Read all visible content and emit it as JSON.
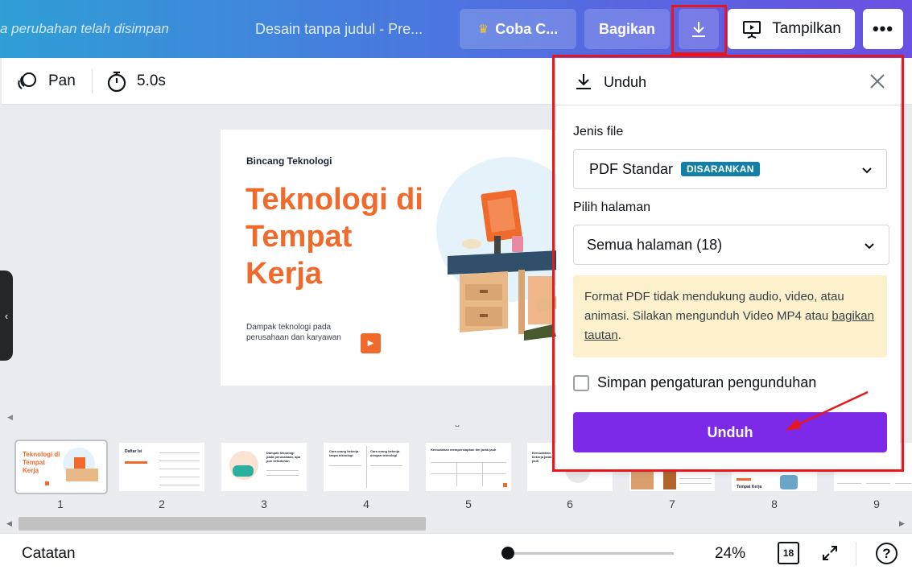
{
  "topbar": {
    "saved_message": "a perubahan telah disimpan",
    "doc_title": "Desain tanpa judul - Pre...",
    "try_pro_label": "Coba C...",
    "share_label": "Bagikan",
    "present_label": "Tampilkan",
    "more_label": "•••"
  },
  "toolbar": {
    "pan_label": "Pan",
    "timer_label": "5.0s"
  },
  "slide": {
    "kicker": "Bincang Teknologi",
    "title": "Teknologi di Tempat Kerja",
    "description": "Dampak teknologi pada perusahaan dan karyawan"
  },
  "thumbnails": [
    {
      "number": "1"
    },
    {
      "number": "2"
    },
    {
      "number": "3"
    },
    {
      "number": "4"
    },
    {
      "number": "5"
    },
    {
      "number": "6"
    },
    {
      "number": "7"
    },
    {
      "number": "8"
    },
    {
      "number": "9"
    }
  ],
  "thumb_text": {
    "t1_title": "Teknologi di Tempat Kerja",
    "t2_title": "Daftar Isi",
    "t3_title": "Dampak teknologi pada perusahaan, apa pun kebutuhan",
    "t4_left": "Cara orang bekerja tanpa teknologi",
    "t4_right": "Cara orang bekerja dengan teknologi",
    "t5_title": "Kemudahan mempersiapkan tim jarak jauh",
    "t6_title": "Kemudahan bekerja jarak jauh",
    "t8_title": "Tempat Kerja"
  },
  "footer": {
    "notes_label": "Catatan",
    "zoom_value": "24%",
    "page_count": "18",
    "help_label": "?",
    "zoom_level": 0.0
  },
  "download_panel": {
    "title": "Unduh",
    "file_type_label": "Jenis file",
    "file_type_value": "PDF Standar",
    "recommended_badge": "DISARANKAN",
    "pages_label": "Pilih halaman",
    "pages_value": "Semua halaman (18)",
    "notice_text": "Format PDF tidak mendukung audio, video, atau animasi. Silakan mengunduh Video MP4 atau ",
    "notice_link": "bagikan tautan",
    "notice_end": ".",
    "save_settings_label": "Simpan pengaturan pengunduhan",
    "save_settings_checked": false,
    "download_button_label": "Unduh"
  },
  "colors": {
    "accent_purple": "#7d2ae8",
    "slide_orange": "#ef6a2b",
    "badge_blue": "#127fa6",
    "annotation_red": "#e8161d",
    "notice_bg": "#fdf1cd"
  },
  "icons": {
    "pan": "pan-icon",
    "timer": "stopwatch-icon",
    "download": "download-icon",
    "present": "present-icon",
    "close": "close-icon",
    "chevron": "chevron-down-icon",
    "expand": "fullscreen-icon",
    "help": "help-icon"
  }
}
